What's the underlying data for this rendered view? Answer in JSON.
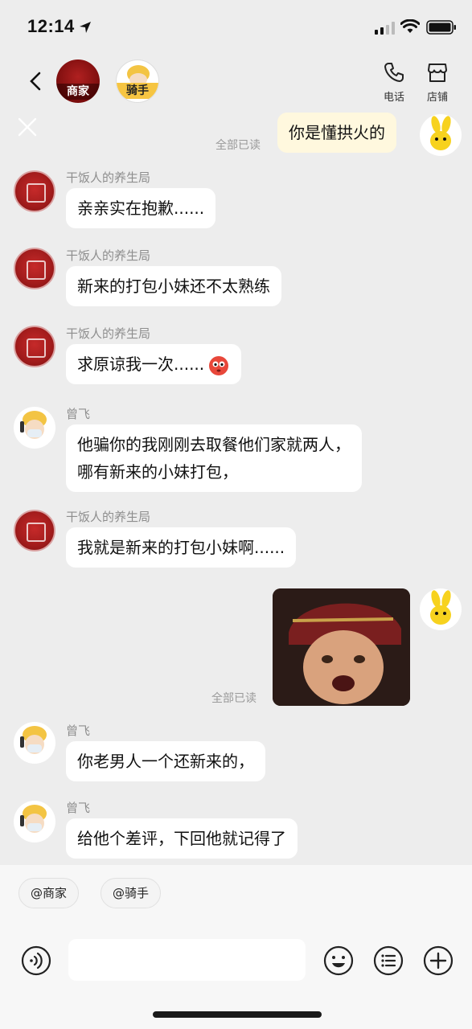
{
  "status_bar": {
    "time": "12:14"
  },
  "header": {
    "merchant_tag": "商家",
    "rider_tag": "骑手",
    "phone_label": "电话",
    "store_label": "店铺"
  },
  "messages": {
    "m0": {
      "text": "你是懂拱火的",
      "read": "全部已读"
    },
    "m1": {
      "sender": "干饭人的养生局",
      "text": "亲亲实在抱歉......"
    },
    "m2": {
      "sender": "干饭人的养生局",
      "text": "新来的打包小妹还不太熟练"
    },
    "m3": {
      "sender": "干饭人的养生局",
      "text": "求原谅我一次......"
    },
    "m4": {
      "sender": "曾飞",
      "line1": "他骗你的我刚刚去取餐他们家就两人，",
      "line2": "哪有新来的小妹打包，"
    },
    "m5": {
      "sender": "干饭人的养生局",
      "text": "我就是新来的打包小妹啊......"
    },
    "m6": {
      "read": "全部已读"
    },
    "m7": {
      "sender": "曾飞",
      "text": "你老男人一个还新来的，"
    },
    "m8": {
      "sender": "曾飞",
      "text": "给他个差评，下回他就记得了"
    }
  },
  "bottom": {
    "mention_merchant": "@商家",
    "mention_rider": "@骑手",
    "input_value": ""
  },
  "colors": {
    "background": "#ededed",
    "bubble": "#ffffff",
    "my_bubble": "#fff8de",
    "merchant_red": "#a51d1d"
  }
}
